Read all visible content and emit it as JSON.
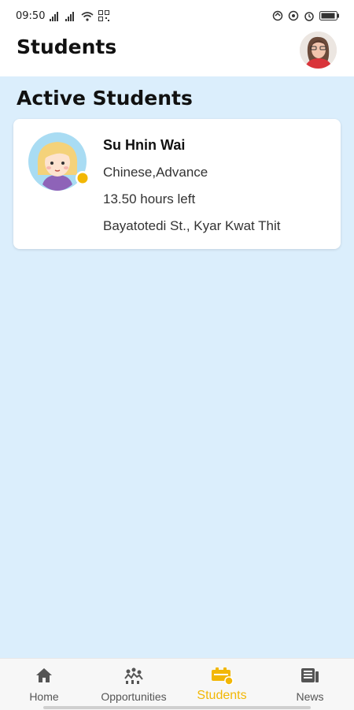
{
  "status_bar": {
    "time": "09:50",
    "icons": [
      "signal-icon",
      "signal-icon",
      "wifi-icon",
      "qr-icon",
      "alarm-icon",
      "battery-icon"
    ]
  },
  "header": {
    "title": "Students",
    "avatar_icon": "user-avatar"
  },
  "section": {
    "title": "Active Students"
  },
  "students": [
    {
      "name": "Su Hnin Wai",
      "course": "Chinese,Advance",
      "hours": "13.50 hours left",
      "address": "Bayatotedi St., Kyar Kwat Thit",
      "status_color": "#f2b705"
    }
  ],
  "bottom_nav": {
    "items": [
      {
        "label": "Home",
        "icon": "home-icon",
        "active": false
      },
      {
        "label": "Opportunities",
        "icon": "opportunities-icon",
        "active": false
      },
      {
        "label": "Students",
        "icon": "students-icon",
        "active": true
      },
      {
        "label": "News",
        "icon": "news-icon",
        "active": false
      }
    ]
  },
  "colors": {
    "accent": "#f2b705",
    "background": "#dbeefc",
    "card": "#ffffff"
  }
}
